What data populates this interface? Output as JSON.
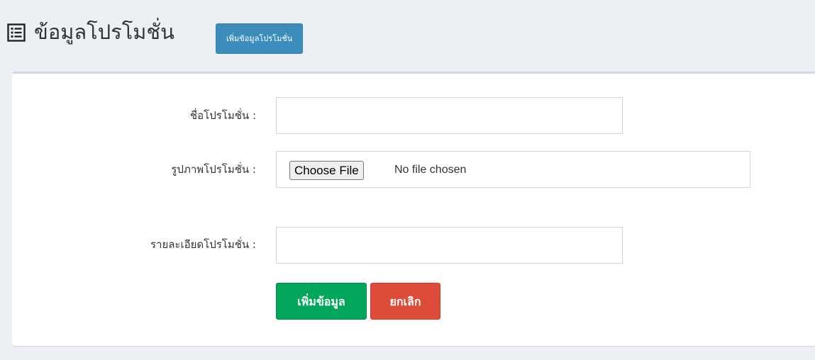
{
  "header": {
    "title": "ข้อมูลโปรโมชั่น",
    "add_button_label": "เพิ่มข้อมูลโปรโมชั่น",
    "icon": "list-alt-icon"
  },
  "form": {
    "name_label": "ชื่อโปรโมชั่น :",
    "name_value": "",
    "image_label": "รูปภาพโปรโมชั่น :",
    "choose_file_label": "Choose File",
    "no_file_text": "No file chosen",
    "detail_label": "รายละเอียดโปรโมชั่น :",
    "detail_value": "",
    "submit_label": "เพิ่มข้อมูล",
    "cancel_label": "ยกเลิก"
  },
  "colors": {
    "background": "#ecf0f5",
    "primary": "#3c8dbc",
    "success": "#00a65a",
    "danger": "#dd4b39"
  }
}
